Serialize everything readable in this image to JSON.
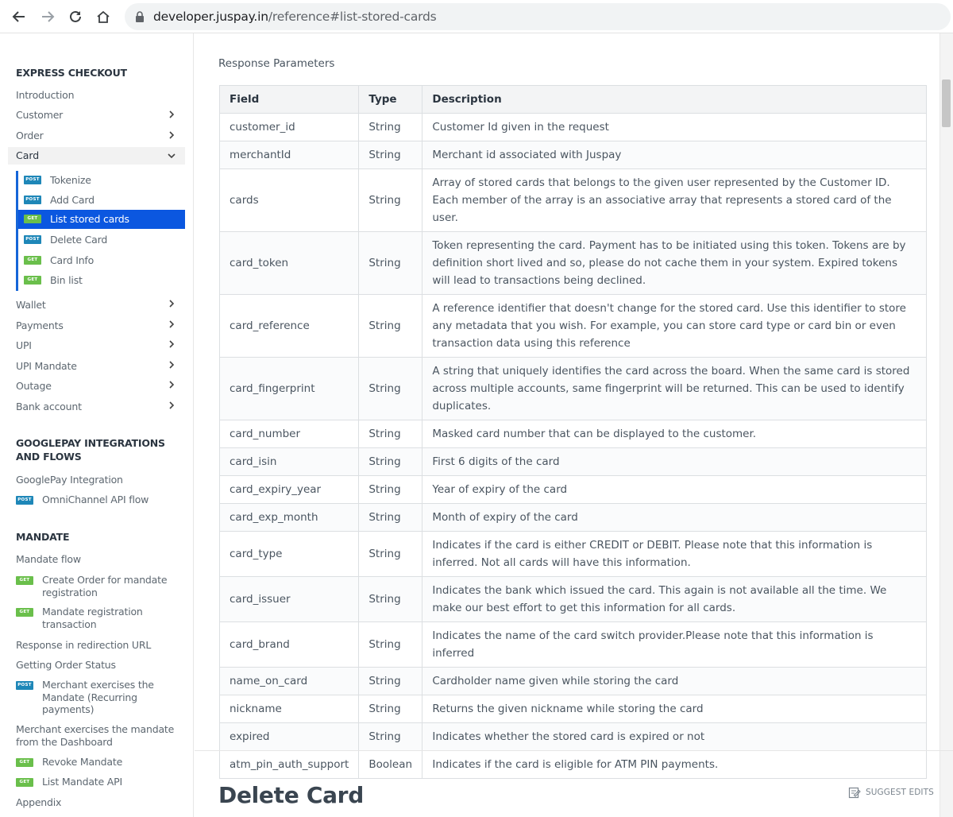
{
  "browser": {
    "url_host": "developer.juspay.in",
    "url_path": "/reference#list-stored-cards"
  },
  "sidebar": {
    "express_checkout": {
      "title": "EXPRESS CHECKOUT",
      "items": [
        {
          "label": "Introduction"
        },
        {
          "label": "Customer"
        },
        {
          "label": "Order"
        },
        {
          "label": "Card"
        }
      ],
      "card_subitems": [
        {
          "method": "POST",
          "label": "Tokenize"
        },
        {
          "method": "POST",
          "label": "Add Card"
        },
        {
          "method": "GET",
          "label": "List stored cards"
        },
        {
          "method": "POST",
          "label": "Delete Card"
        },
        {
          "method": "GET",
          "label": "Card Info"
        },
        {
          "method": "GET",
          "label": "Bin list"
        }
      ],
      "more_items": [
        {
          "label": "Wallet"
        },
        {
          "label": "Payments"
        },
        {
          "label": "UPI"
        },
        {
          "label": "UPI Mandate"
        },
        {
          "label": "Outage"
        },
        {
          "label": "Bank account"
        }
      ]
    },
    "googlepay": {
      "title": "GOOGLEPAY INTEGRATIONS AND FLOWS",
      "items": [
        {
          "label": "GooglePay Integration"
        },
        {
          "method": "POST",
          "label": "OmniChannel API flow"
        }
      ]
    },
    "mandate": {
      "title": "MANDATE",
      "items": [
        {
          "label": "Mandate flow"
        },
        {
          "method": "GET",
          "label": "Create Order for mandate registration"
        },
        {
          "method": "GET",
          "label": "Mandate registration transaction"
        },
        {
          "label": "Response in redirection URL"
        },
        {
          "label": "Getting Order Status"
        },
        {
          "method": "POST",
          "label": "Merchant exercises the Mandate (Recurring payments)"
        },
        {
          "label": "Merchant exercises the mandate from the Dashboard"
        },
        {
          "method": "GET",
          "label": "Revoke Mandate"
        },
        {
          "method": "GET",
          "label": "List Mandate API"
        },
        {
          "label": "Appendix"
        }
      ]
    }
  },
  "main": {
    "response_title": "Response Parameters",
    "table": {
      "headers": [
        "Field",
        "Type",
        "Description"
      ],
      "rows": [
        [
          "customer_id",
          "String",
          "Customer Id given in the request"
        ],
        [
          "merchantId",
          "String",
          "Merchant id associated with Juspay"
        ],
        [
          "cards",
          "String",
          "Array of stored cards that belongs to the given user represented by the Customer ID. Each member of the array is an associative array that represents a stored card of the user."
        ],
        [
          "card_token",
          "String",
          "Token representing the card. Payment has to be initiated using this token. Tokens are by definition short lived and so, please do not cache them in your system. Expired tokens will lead to transactions being declined."
        ],
        [
          "card_reference",
          "String",
          "A reference identifier that doesn't change for the stored card. Use this identifier to store any metadata that you wish. For example, you can store card type or card bin or even transaction data using this reference"
        ],
        [
          "card_fingerprint",
          "String",
          "A string that uniquely identifies the card across the board. When the same card is stored across multiple accounts, same fingerprint will be returned. This can be used to identify duplicates."
        ],
        [
          "card_number",
          "String",
          "Masked card number that can be displayed to the customer."
        ],
        [
          "card_isin",
          "String",
          "First 6 digits of the card"
        ],
        [
          "card_expiry_year",
          "String",
          "Year of expiry of the card"
        ],
        [
          "card_exp_month",
          "String",
          "Month of expiry of the card"
        ],
        [
          "card_type",
          "String",
          "Indicates if the card is either CREDIT or DEBIT. Please note that this information is inferred. Not all cards will have this information."
        ],
        [
          "card_issuer",
          "String",
          "Indicates the bank which issued the card. This again is not available all the time. We make our best effort to get this information for all cards."
        ],
        [
          "card_brand",
          "String",
          "Indicates the name of the card switch provider.Please note that this information is inferred"
        ],
        [
          "name_on_card",
          "String",
          "Cardholder name given while storing the card"
        ],
        [
          "nickname",
          "String",
          "Returns the given nickname while storing the card"
        ],
        [
          "expired",
          "String",
          "Indicates whether the stored card is expired or not"
        ],
        [
          "atm_pin_auth_support",
          "Boolean",
          "Indicates if the card is eligible for ATM PIN payments."
        ]
      ]
    },
    "next_section_title": "Delete Card",
    "suggest_edits": "SUGGEST EDITS"
  }
}
